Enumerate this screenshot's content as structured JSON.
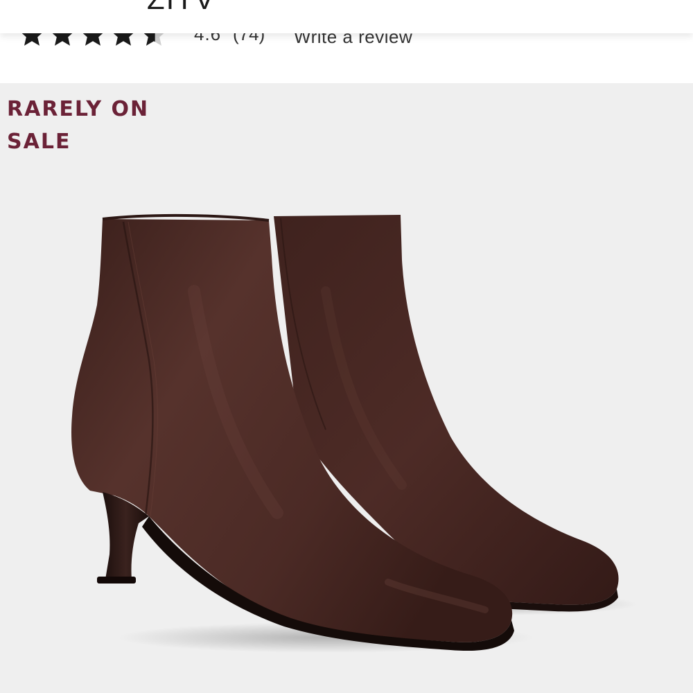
{
  "header": {
    "brand": "ZITV"
  },
  "rating": {
    "stars_filled": 4.5,
    "stars_total": 5,
    "value": "4.6",
    "count": "(74)",
    "write_review_label": "Write a review"
  },
  "product": {
    "badge": "RARELY ON SALE",
    "image_alt": "brown leather pointed-toe ankle boots with kitten heel",
    "colors": {
      "badge": "#6b2237",
      "background": "#efefef",
      "leather": "#4a2a25"
    }
  }
}
